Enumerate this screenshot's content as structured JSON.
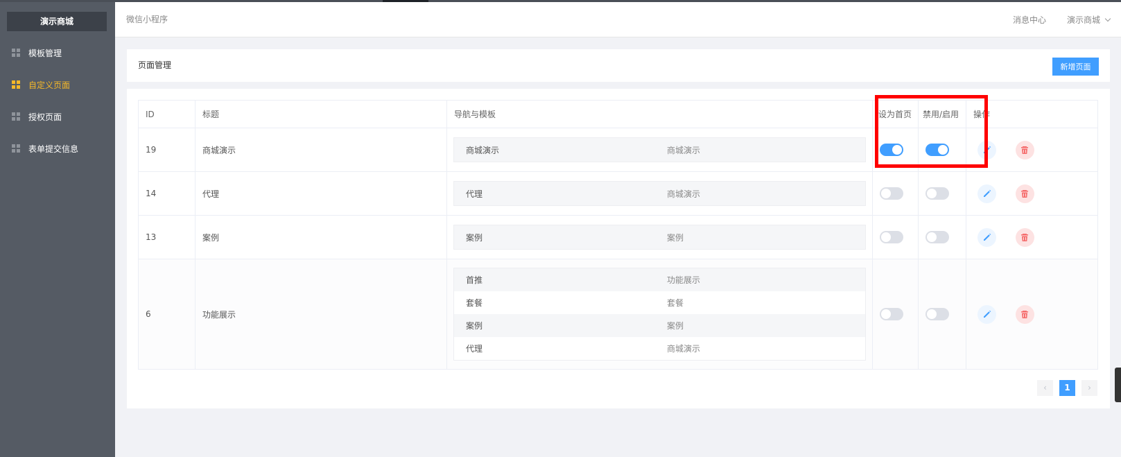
{
  "sidebar": {
    "brand": "演示商城",
    "items": [
      {
        "label": "模板管理",
        "active": false
      },
      {
        "label": "自定义页面",
        "active": true
      },
      {
        "label": "授权页面",
        "active": false
      },
      {
        "label": "表单提交信息",
        "active": false
      }
    ]
  },
  "header": {
    "title": "微信小程序",
    "messages": "消息中心",
    "shop": "演示商城"
  },
  "page": {
    "title": "页面管理",
    "add_button": "新增页面"
  },
  "table": {
    "columns": {
      "id": "ID",
      "title": "标题",
      "nav": "导航与模板",
      "set_home": "设为首页",
      "toggle": "禁用/启用",
      "actions": "操作"
    },
    "rows": [
      {
        "id": "19",
        "title": "商城演示",
        "nav": [
          {
            "name": "商城演示",
            "template": "商城演示"
          }
        ],
        "home": true,
        "enabled": true
      },
      {
        "id": "14",
        "title": "代理",
        "nav": [
          {
            "name": "代理",
            "template": "商城演示"
          }
        ],
        "home": false,
        "enabled": false
      },
      {
        "id": "13",
        "title": "案例",
        "nav": [
          {
            "name": "案例",
            "template": "案例"
          }
        ],
        "home": false,
        "enabled": false
      },
      {
        "id": "6",
        "title": "功能展示",
        "nav": [
          {
            "name": "首推",
            "template": "功能展示"
          },
          {
            "name": "套餐",
            "template": "套餐"
          },
          {
            "name": "案例",
            "template": "案例"
          },
          {
            "name": "代理",
            "template": "商城演示"
          }
        ],
        "home": false,
        "enabled": false
      }
    ]
  },
  "pagination": {
    "prev": "‹",
    "current": "1",
    "next": "›"
  },
  "colors": {
    "primary": "#409eff",
    "sidebar": "#555b64",
    "active_nav": "#f5b829",
    "highlight": "#ff0000",
    "delete": "#f56c6c"
  }
}
